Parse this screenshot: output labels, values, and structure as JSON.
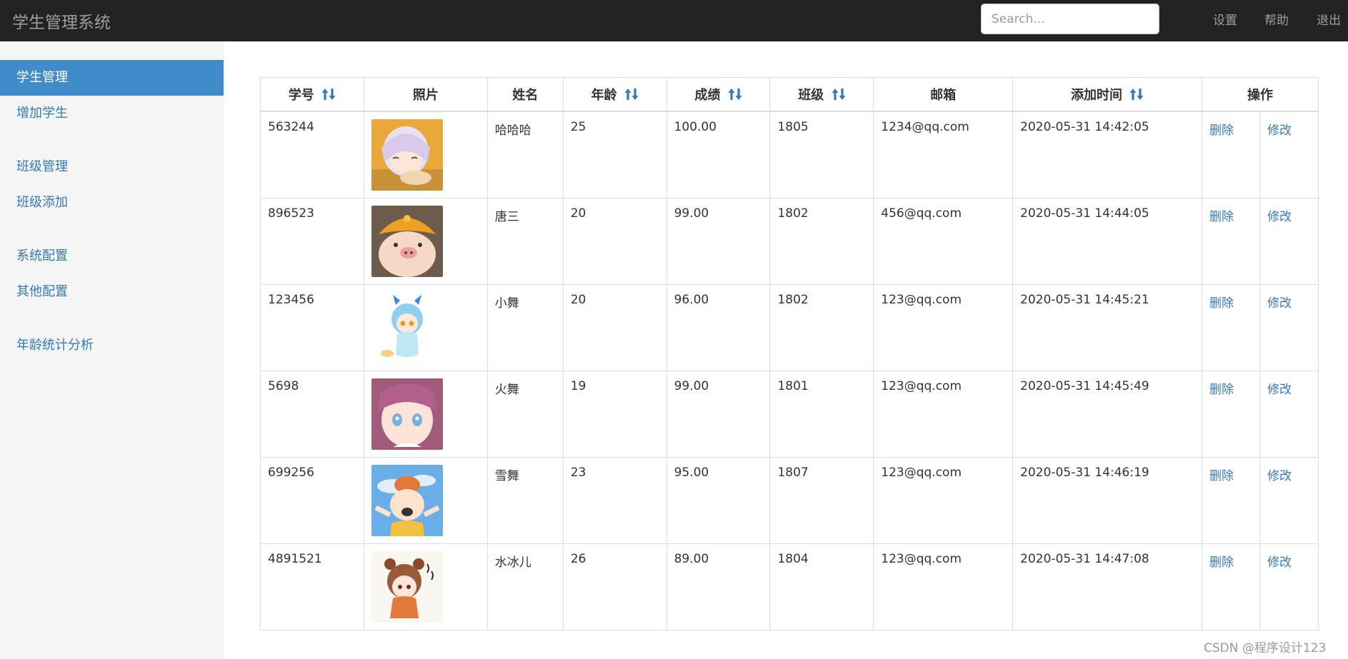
{
  "app": {
    "title": "学生管理系统"
  },
  "search": {
    "placeholder": "Search..."
  },
  "nav": {
    "settings": "设置",
    "help": "帮助",
    "logout": "退出"
  },
  "sidebar": {
    "items": [
      "学生管理",
      "增加学生",
      "班级管理",
      "班级添加",
      "系统配置",
      "其他配置",
      "年龄统计分析"
    ],
    "active": "学生管理"
  },
  "table": {
    "headers": {
      "id": "学号",
      "photo": "照片",
      "name": "姓名",
      "age": "年龄",
      "score": "成绩",
      "class": "班级",
      "email": "邮箱",
      "time": "添加时间",
      "actions": "操作"
    },
    "rows": [
      {
        "id": "563244",
        "name": "哈哈哈",
        "age": "25",
        "score": "100.00",
        "class": "1805",
        "email": "1234@qq.com",
        "time": "2020-05-31 14:42:05",
        "delete": "删除",
        "edit": "修改"
      },
      {
        "id": "896523",
        "name": "唐三",
        "age": "20",
        "score": "99.00",
        "class": "1802",
        "email": "456@qq.com",
        "time": "2020-05-31 14:44:05",
        "delete": "删除",
        "edit": "修改"
      },
      {
        "id": "123456",
        "name": "小舞",
        "age": "20",
        "score": "96.00",
        "class": "1802",
        "email": "123@qq.com",
        "time": "2020-05-31 14:45:21",
        "delete": "删除",
        "edit": "修改"
      },
      {
        "id": "5698",
        "name": "火舞",
        "age": "19",
        "score": "99.00",
        "class": "1801",
        "email": "123@qq.com",
        "time": "2020-05-31 14:45:49",
        "delete": "删除",
        "edit": "修改"
      },
      {
        "id": "699256",
        "name": "雪舞",
        "age": "23",
        "score": "95.00",
        "class": "1807",
        "email": "123@qq.com",
        "time": "2020-05-31 14:46:19",
        "delete": "删除",
        "edit": "修改"
      },
      {
        "id": "4891521",
        "name": "水冰儿",
        "age": "26",
        "score": "89.00",
        "class": "1804",
        "email": "123@qq.com",
        "time": "2020-05-31 14:47:08",
        "delete": "删除",
        "edit": "修改"
      }
    ]
  },
  "watermark": "CSDN @程序设计123",
  "colors": {
    "navbar": "#222222",
    "accent": "#428bca",
    "link": "#337ab7",
    "sidebar": "#f5f5f5"
  }
}
